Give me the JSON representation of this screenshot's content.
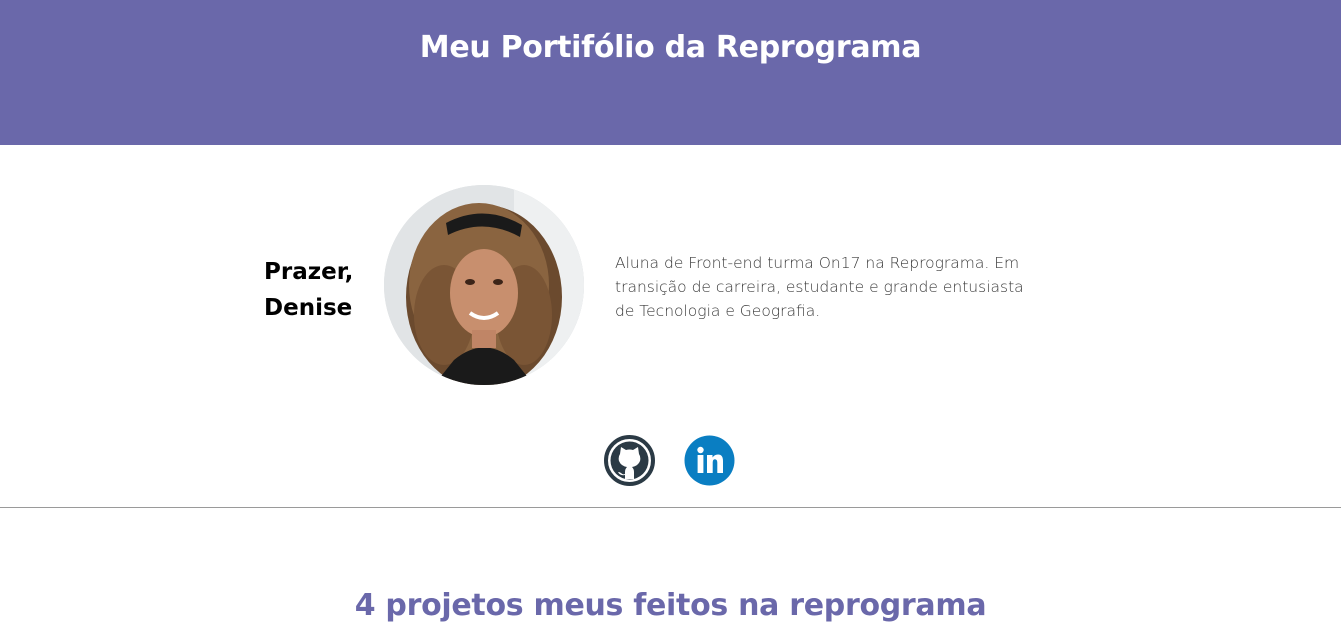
{
  "header": {
    "title": "Meu Portifólio da Reprograma",
    "background": "#6a68aa"
  },
  "profile": {
    "greeting_line1": "Prazer,",
    "greeting_line2": "Denise",
    "bio": "Aluna de Front-end turma On17 na Reprograma. Em transição de carreira, estudante e grande entusiasta de Tecnologia e Geografia."
  },
  "social": [
    {
      "name": "GitHub",
      "icon": "github-icon",
      "color": "#2b3a45"
    },
    {
      "name": "LinkedIn",
      "icon": "linkedin-icon",
      "color": "#0a7ec2"
    }
  ],
  "projects": {
    "title": "4 projetos meus feitos na reprograma",
    "color": "#6a68aa"
  }
}
